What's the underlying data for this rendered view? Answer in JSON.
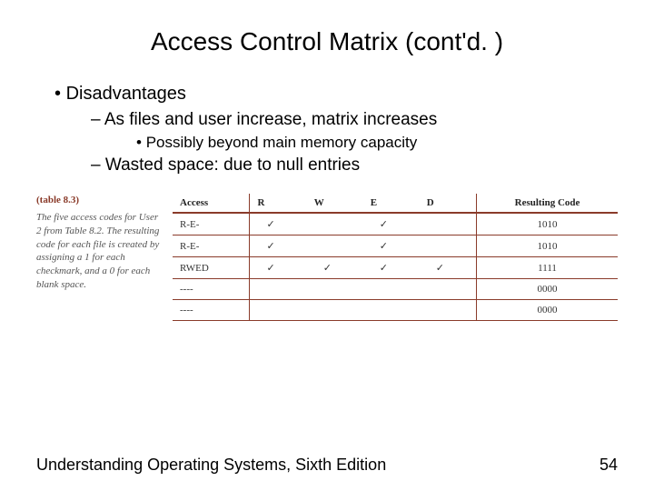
{
  "title": "Access Control Matrix (cont'd. )",
  "bullets": {
    "b1": "Disadvantages",
    "b2a": "As files and user increase, matrix increases",
    "b3a": "Possibly beyond main memory capacity",
    "b2b": "Wasted space: due to null entries"
  },
  "table": {
    "label": "(table 8.3)",
    "caption": "The five access codes for User 2 from Table 8.2. The resulting code for each file is created by assigning a 1 for each checkmark, and a 0 for each blank space.",
    "headers": [
      "Access",
      "R",
      "W",
      "E",
      "D",
      "Resulting Code"
    ],
    "rows": [
      {
        "access": "R-E-",
        "r": "✓",
        "w": "",
        "e": "✓",
        "d": "",
        "code": "1010"
      },
      {
        "access": "R-E-",
        "r": "✓",
        "w": "",
        "e": "✓",
        "d": "",
        "code": "1010"
      },
      {
        "access": "RWED",
        "r": "✓",
        "w": "✓",
        "e": "✓",
        "d": "✓",
        "code": "1111"
      },
      {
        "access": "----",
        "r": "",
        "w": "",
        "e": "",
        "d": "",
        "code": "0000"
      },
      {
        "access": "----",
        "r": "",
        "w": "",
        "e": "",
        "d": "",
        "code": "0000"
      }
    ]
  },
  "footer": {
    "book": "Understanding Operating Systems, Sixth Edition",
    "page": "54"
  },
  "chart_data": {
    "type": "table",
    "title": "(table 8.3)",
    "columns": [
      "Access",
      "R",
      "W",
      "E",
      "D",
      "Resulting Code"
    ],
    "rows": [
      [
        "R-E-",
        "✓",
        "",
        "✓",
        "",
        "1010"
      ],
      [
        "R-E-",
        "✓",
        "",
        "✓",
        "",
        "1010"
      ],
      [
        "RWED",
        "✓",
        "✓",
        "✓",
        "✓",
        "1111"
      ],
      [
        "----",
        "",
        "",
        "",
        "",
        "0000"
      ],
      [
        "----",
        "",
        "",
        "",
        "",
        "0000"
      ]
    ]
  }
}
